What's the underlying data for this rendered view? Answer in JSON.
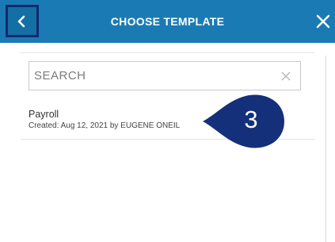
{
  "header": {
    "title": "CHOOSE TEMPLATE",
    "back_icon": "chevron-left-icon",
    "close_icon": "close-icon"
  },
  "search": {
    "placeholder": "SEARCH",
    "value": "",
    "clear_icon": "close-icon"
  },
  "templates": [
    {
      "name": "Payroll",
      "meta": "Created: Aug 12, 2021 by EUGENE ONEIL"
    }
  ],
  "callout": {
    "label": "3",
    "color": "#14307a"
  },
  "colors": {
    "header": "#1a7bb4",
    "back_highlight_border": "#10296f"
  }
}
